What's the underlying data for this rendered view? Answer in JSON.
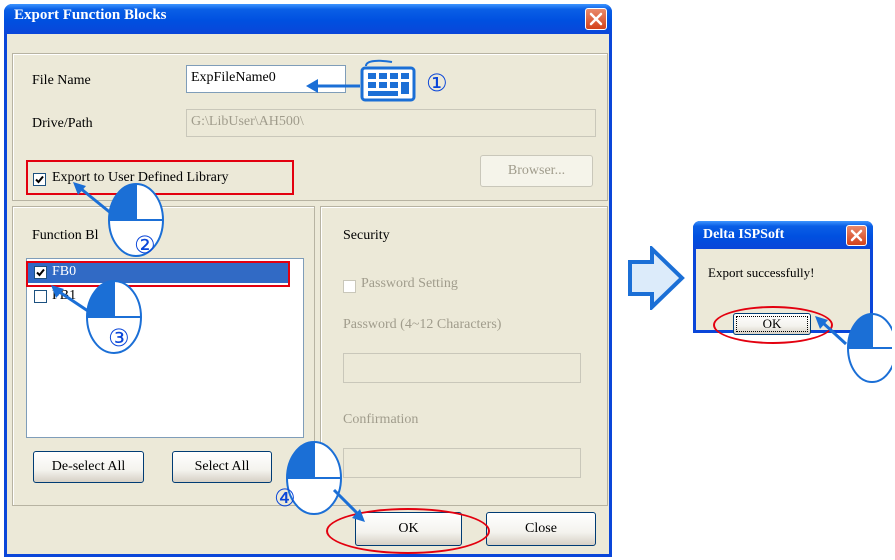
{
  "main_dialog": {
    "title": "Export Function Blocks",
    "file_name_label": "File Name",
    "file_name_value": "ExpFileName0",
    "drive_path_label": "Drive/Path",
    "drive_path_value": "G:\\LibUser\\AH500\\",
    "export_checkbox_label": "Export to User Defined Library",
    "export_checkbox_checked": true,
    "browser_button": "Browser...",
    "function_blocks_label": "Function Bl",
    "function_blocks": [
      {
        "label": "FB0",
        "checked": true,
        "selected": true
      },
      {
        "label": "FB1",
        "checked": false,
        "selected": false
      }
    ],
    "deselect_all_button": "De-select All",
    "select_all_button": "Select All",
    "security_label": "Security",
    "password_setting_label": "Password Setting",
    "password_label": "Password (4~12 Characters)",
    "confirmation_label": "Confirmation",
    "ok_button": "OK",
    "close_button": "Close"
  },
  "message_dialog": {
    "title": "Delta ISPSoft",
    "message": "Export successfully!",
    "ok_button": "OK"
  },
  "steps": [
    "①",
    "②",
    "③",
    "④"
  ],
  "colors": {
    "title_blue": "#0a46d9",
    "highlight_red": "#e3000f",
    "dialog_face": "#ece9d8",
    "selection_blue": "#316ac5",
    "arrow_blue": "#1b6fd6"
  },
  "icons": [
    "close-icon",
    "keyboard-icon",
    "mouse-icon",
    "arrow-right-icon"
  ]
}
